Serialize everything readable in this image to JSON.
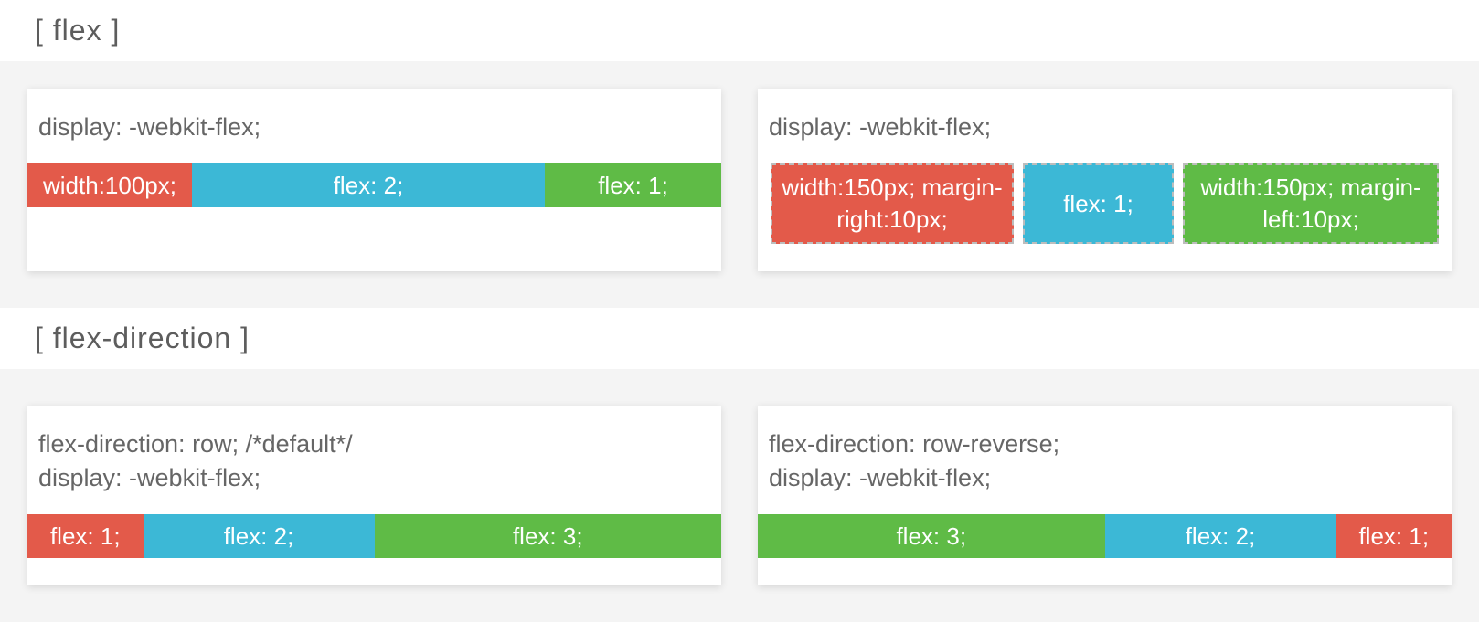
{
  "section1": {
    "title": "[ flex ]",
    "left": {
      "desc": "display: -webkit-flex;",
      "boxes": [
        "width:100px;",
        "flex: 2;",
        "flex: 1;"
      ]
    },
    "right": {
      "desc": "display: -webkit-flex;",
      "boxes": [
        "width:150px;\nmargin-right:10px;",
        "flex: 1;",
        "width:150px;\nmargin-left:10px;"
      ]
    }
  },
  "section2": {
    "title": "[ flex-direction ]",
    "left": {
      "desc": "flex-direction: row; /*default*/\ndisplay: -webkit-flex;",
      "boxes": [
        "flex: 1;",
        "flex: 2;",
        "flex: 3;"
      ]
    },
    "right": {
      "desc": "flex-direction: row-reverse;\ndisplay: -webkit-flex;",
      "boxes": [
        "flex: 1;",
        "flex: 2;",
        "flex: 3;"
      ]
    }
  }
}
